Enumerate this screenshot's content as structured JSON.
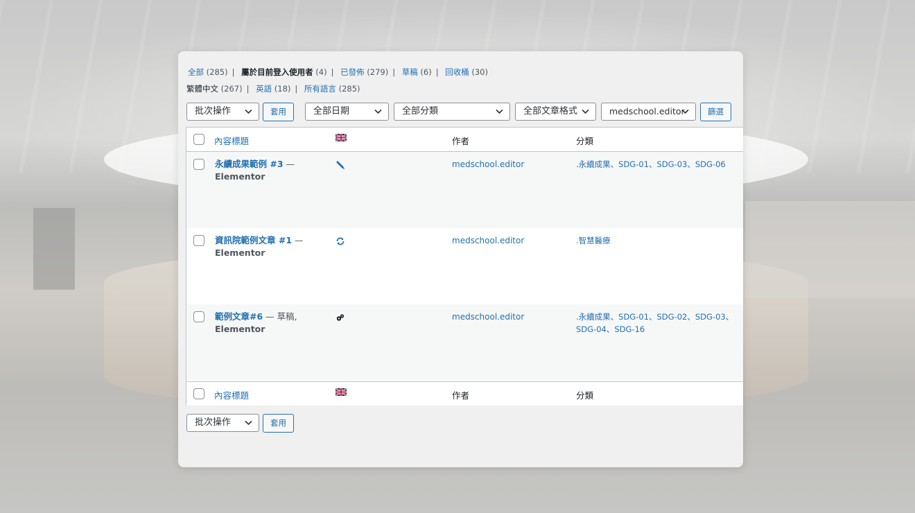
{
  "status_filters": [
    {
      "label": "全部",
      "count": "(285)",
      "current": false
    },
    {
      "label": "屬於目前登入使用者",
      "count": "(4)",
      "current": true
    },
    {
      "label": "已發佈",
      "count": "(279)",
      "current": false
    },
    {
      "label": "草稿",
      "count": "(6)",
      "current": false
    },
    {
      "label": "回收桶",
      "count": "(30)",
      "current": false
    }
  ],
  "language_filters": [
    {
      "label": "繁體中文",
      "count": "(267)",
      "current": true
    },
    {
      "label": "英語",
      "count": "(18)",
      "current": false
    },
    {
      "label": "所有語言",
      "count": "(285)",
      "current": false
    }
  ],
  "toolbar": {
    "bulk_action": "批次操作",
    "apply": "套用",
    "date_filter": "全部日期",
    "category_filter": "全部分類",
    "format_filter": "全部文章格式",
    "author_filter": "medschool.editor",
    "filter_button": "篩選"
  },
  "columns": {
    "title": "內容標題",
    "language_icon": "uk-flag-icon",
    "author": "作者",
    "categories": "分類"
  },
  "rows": [
    {
      "title": "永續成果範例 #3",
      "title_suffix": " —",
      "subtitle": "Elementor",
      "status_icon": "pencil-icon",
      "author": "medschool.editor",
      "categories": ".永續成果、SDG-01、SDG-03、SDG-06"
    },
    {
      "title": "資訊院範例文章 #1",
      "title_suffix": " —",
      "subtitle": "Elementor",
      "status_icon": "sync-icon",
      "author": "medschool.editor",
      "categories": ".智慧醫療"
    },
    {
      "title": "範例文章#6",
      "title_suffix": " — 草稿,",
      "subtitle": "Elementor",
      "status_icon": "translation-icon",
      "author": "medschool.editor",
      "categories": ".永續成果、SDG-01、SDG-02、SDG-03、SDG-04、SDG-16"
    }
  ],
  "bottom_toolbar": {
    "bulk_action": "批次操作",
    "apply": "套用"
  },
  "colors": {
    "link": "#2271b1",
    "text": "#1d2327",
    "panel_bg": "#f0f0f1"
  }
}
